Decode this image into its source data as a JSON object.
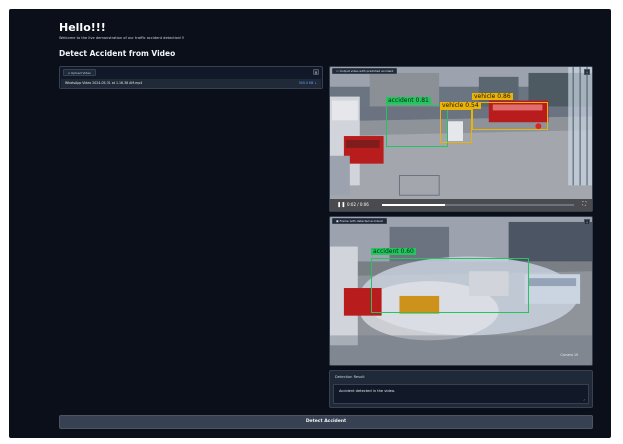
{
  "app": {
    "title": "Hello!!!",
    "welcome": "Welcome to the live demonstration of our traffic accident detection!!!",
    "heading": "Detect Accident from Video"
  },
  "upload": {
    "label": "Upload Video",
    "close_icon": "close-icon",
    "file_name": "WhatsApp Video 2024-05-31 at 1.16.38 AM.mp4",
    "file_size": "500.0 KB ↓"
  },
  "video_panel": {
    "label": "Output video with predicted accident",
    "fullscreen_icon": "download-icon",
    "detections": [
      {
        "label": "accident 0.81",
        "color": "#22c55e"
      },
      {
        "label": "vehicle 0.86",
        "color": "#eab308"
      },
      {
        "label": "vehicle 0.54",
        "color": "#eab308"
      }
    ],
    "player": {
      "play_icon": "pause-icon",
      "time": "0:02 / 0:06",
      "progress": 0.33,
      "fullscreen_icon": "fullscreen-icon"
    }
  },
  "frame_panel": {
    "label": "Frame with detected accident",
    "download_icon": "download-icon",
    "detections": [
      {
        "label": "accident 0.60",
        "color": "#22c55e"
      }
    ],
    "camera_text": "Camera 19"
  },
  "result": {
    "label": "Detection Result",
    "value": "Accident detected in the video."
  },
  "detect_button": "Detect Accident",
  "colors": {
    "background": "#0b0f19",
    "panel": "#111827",
    "accident": "#22c55e",
    "vehicle": "#eab308"
  }
}
